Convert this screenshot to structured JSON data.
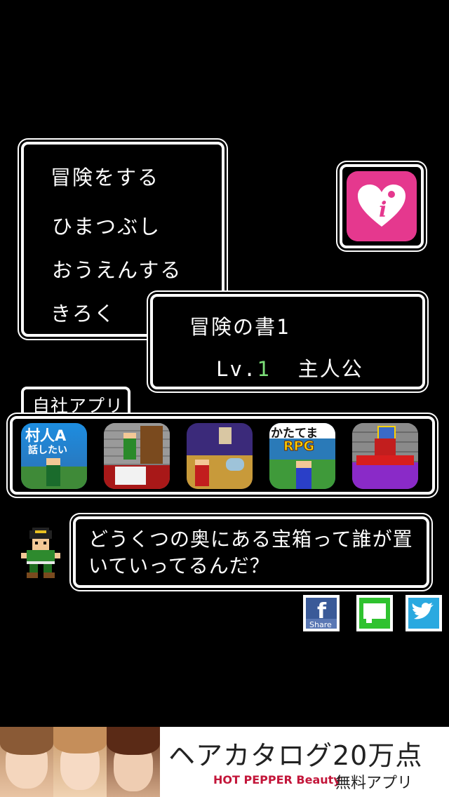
{
  "main_menu": {
    "items": [
      {
        "label": "冒険をする"
      },
      {
        "label": "ひまつぶし"
      },
      {
        "label": "おうえんする"
      },
      {
        "label": "きろく"
      }
    ]
  },
  "promo": {
    "icon": "heart-i-icon",
    "color": "#e5388e"
  },
  "save_file": {
    "title": "冒険の書1",
    "level_prefix": "Lv.",
    "level": "1",
    "character": "主人公",
    "level_color": "#7de07a"
  },
  "apps_section": {
    "tab_label": "自社アプリ",
    "apps": [
      {
        "icon": "villager-a-app-icon",
        "text_line1": "村人A",
        "text_line2": "話したい"
      },
      {
        "icon": "room-game-app-icon"
      },
      {
        "icon": "battle-game-app-icon"
      },
      {
        "icon": "katatema-rpg-app-icon",
        "text_line1": "かたてま",
        "text_line2": "RPG"
      },
      {
        "icon": "treasure-game-app-icon"
      }
    ]
  },
  "dialogue": {
    "text": "どうくつの奥にある宝箱って誰が置いていってるんだ？",
    "speaker_icon": "hero-sprite-icon"
  },
  "social": {
    "facebook_label": "Share",
    "facebook_letter": "f"
  },
  "ad": {
    "headline": "ヘアカタログ20万点",
    "brand": "HOT PEPPER Beauty",
    "free_app": "無料アプリ"
  }
}
